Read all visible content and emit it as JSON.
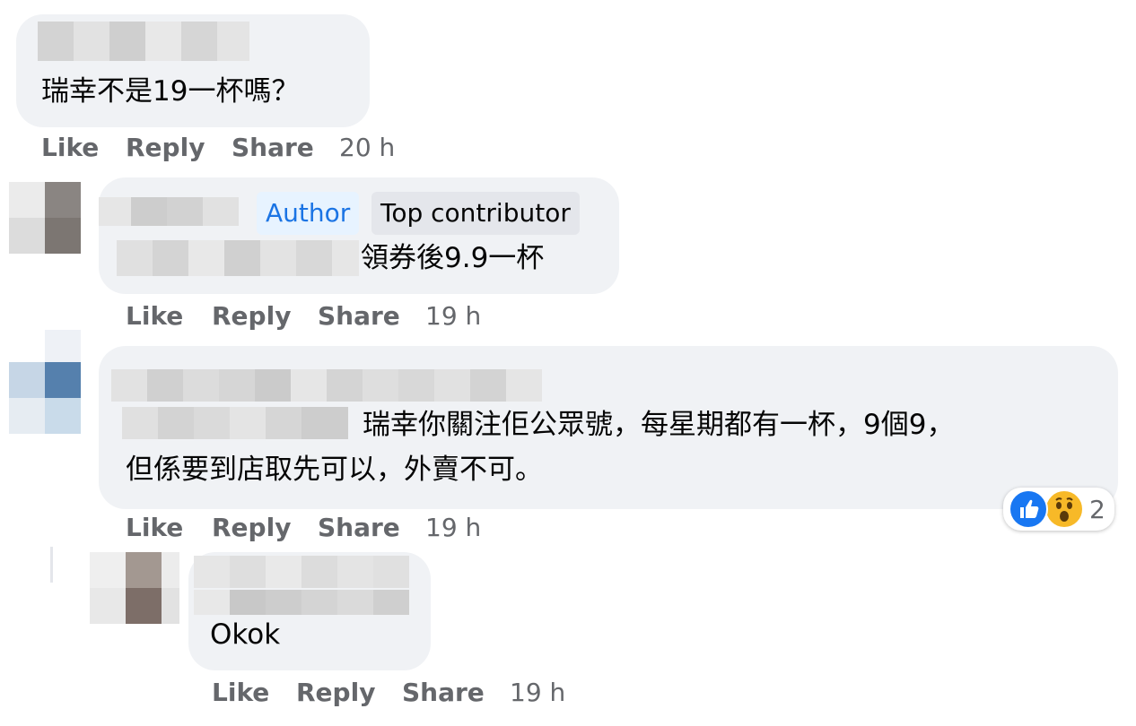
{
  "comments": [
    {
      "text": "瑞幸不是19一杯嗎？",
      "actions": {
        "like": "Like",
        "reply": "Reply",
        "share": "Share",
        "time": "20 h"
      }
    },
    {
      "badges": {
        "author": "Author",
        "top_contributor": "Top contributor"
      },
      "text": "領券後9.9一杯",
      "actions": {
        "like": "Like",
        "reply": "Reply",
        "share": "Share",
        "time": "19 h"
      }
    },
    {
      "text_line1": "瑞幸你關注佢公眾號，每星期都有一杯，9個9，",
      "text_line2": "但係要到店取先可以，外賣不可。",
      "reactions": {
        "icons": [
          "like-icon",
          "wow-icon"
        ],
        "count": "2"
      },
      "actions": {
        "like": "Like",
        "reply": "Reply",
        "share": "Share",
        "time": "19 h"
      }
    },
    {
      "text": "Okok",
      "actions": {
        "like": "Like",
        "reply": "Reply",
        "share": "Share",
        "time": "19 h"
      }
    }
  ],
  "colors": {
    "bubble": "#f0f2f5",
    "action_text": "#65676b",
    "author_badge_bg": "#e7f3ff",
    "author_badge_text": "#1b74e4",
    "like_blue": "#1877f2",
    "wow_yellow": "#f7b928"
  }
}
